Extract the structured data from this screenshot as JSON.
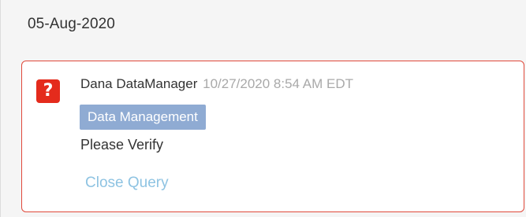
{
  "section": {
    "date": "05-Aug-2020"
  },
  "query": {
    "icon": "question-mark-icon",
    "icon_glyph": "?",
    "author": "Dana DataManager",
    "timestamp": "10/27/2020 8:54 AM EDT",
    "role_badge": "Data Management",
    "message": "Please Verify",
    "close_label": "Close Query"
  },
  "colors": {
    "card_border": "#e0493b",
    "icon_bg": "#e42b1c",
    "badge_bg": "#8fabd3",
    "link": "#8ec3e2",
    "muted_text": "#a9a9a9"
  }
}
